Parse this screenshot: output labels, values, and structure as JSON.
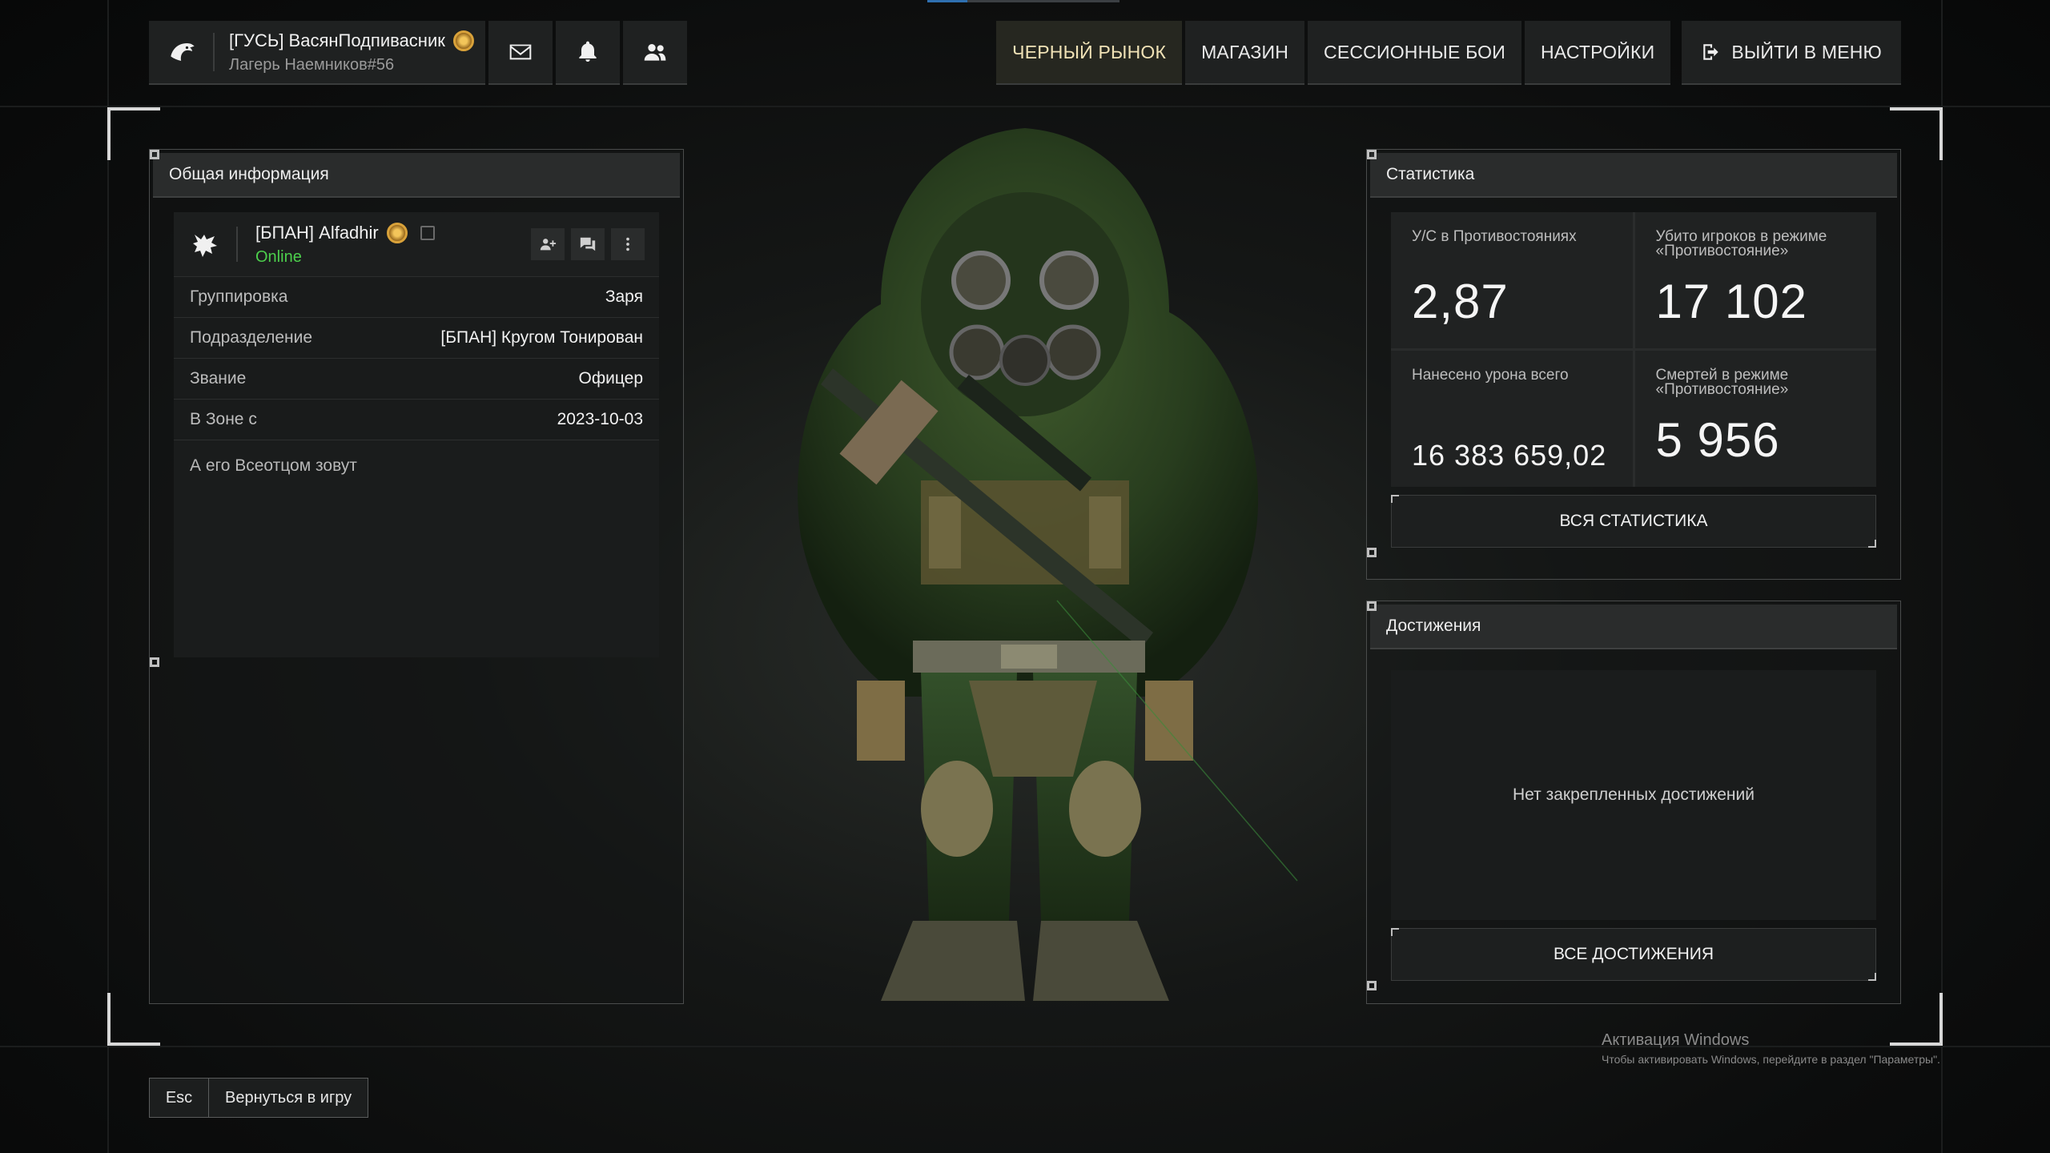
{
  "header": {
    "player_name": "[ГУСЬ] ВасянПодпиваcник",
    "player_sub": "Лагерь Наемников#56"
  },
  "nav": {
    "black_market": "ЧЕРНЫЙ РЫНОК",
    "shop": "МАГАЗИН",
    "session_battles": "СЕССИОННЫЕ БОИ",
    "settings": "НАСТРОЙКИ",
    "exit_menu": "ВЫЙТИ В МЕНЮ"
  },
  "general": {
    "title": "Общая информация",
    "profile_name": "[БПАН] Alfadhir",
    "status": "Online",
    "rows": [
      {
        "key": "Группировка",
        "value": "Заря"
      },
      {
        "key": "Подразделение",
        "value": "[БПАН] Кругом Тонирован"
      },
      {
        "key": "Звание",
        "value": "Офицер"
      },
      {
        "key": "В Зоне с",
        "value": "2023-10-03"
      }
    ],
    "bio": "А его Всеотцом зовут"
  },
  "stats": {
    "title": "Статистика",
    "cells": [
      {
        "label": "У/С в Противостояниях",
        "value": "2,87"
      },
      {
        "label": "Убито игроков в режиме «Противостояние»",
        "value": "17 102"
      },
      {
        "label": "Нанесено урона всего",
        "value": "16 383 659,02"
      },
      {
        "label": "Смертей в режиме «Противостояние»",
        "value": "5 956"
      }
    ],
    "all_button": "ВСЯ СТАТИСТИКА"
  },
  "achievements": {
    "title": "Достижения",
    "empty_text": "Нет закрепленных достижений",
    "all_button": "ВСЕ ДОСТИЖЕНИЯ"
  },
  "bottom": {
    "key": "Esc",
    "label": "Вернуться в игру"
  },
  "windows_activation": {
    "title": "Активация Windows",
    "subtitle": "Чтобы активировать Windows, перейдите в раздел \"Параметры\"."
  },
  "colors": {
    "online": "#4ccf4c",
    "accent_nav": "#f0e2b6",
    "rank_badge": "#d9a23a"
  },
  "icons": [
    "goose-logo-icon",
    "mail-icon",
    "bell-icon",
    "friends-icon",
    "exit-icon",
    "wolf-logo-icon",
    "add-friend-icon",
    "chat-icon",
    "more-icon",
    "copy-icon",
    "rank-badge-icon"
  ]
}
